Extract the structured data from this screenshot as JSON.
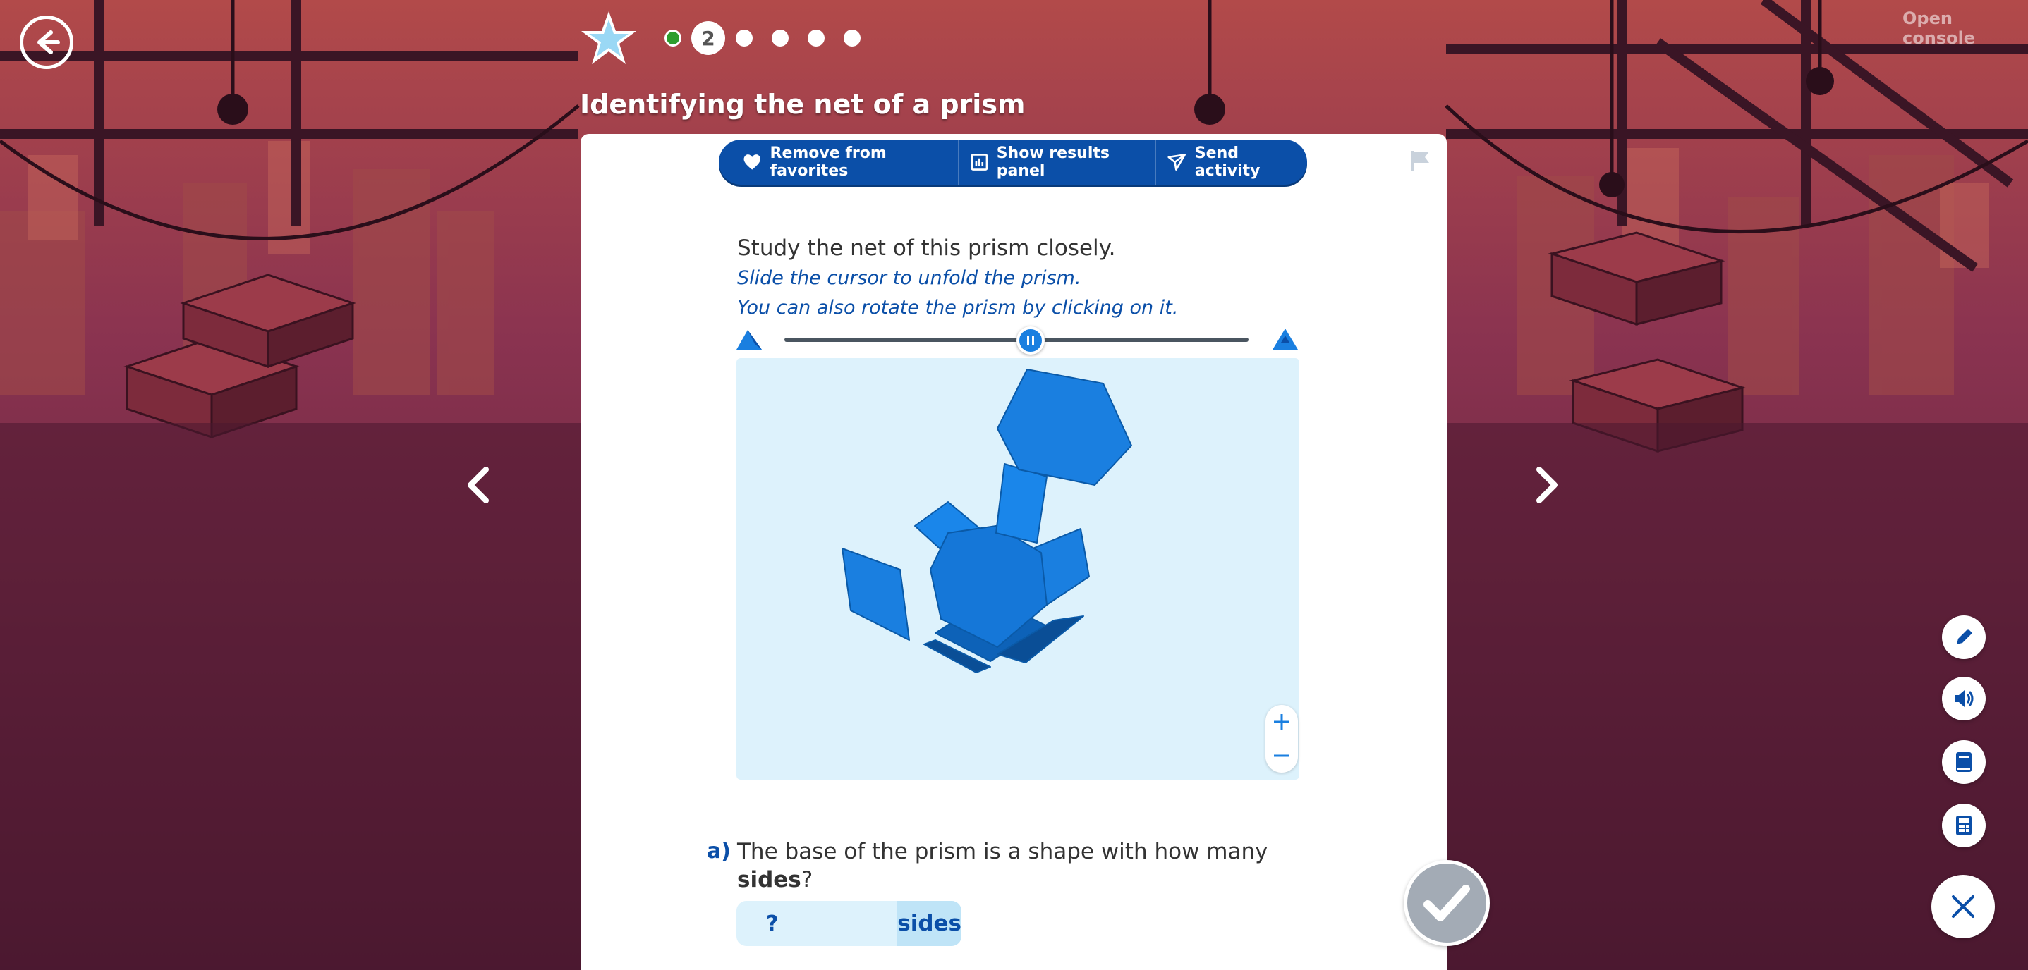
{
  "header": {
    "open_console": "Open console",
    "title": "Identifying the net of a prism",
    "progress": {
      "current_step": "2",
      "total_steps": 6,
      "completed_step_color": "#2e9e2e"
    }
  },
  "toolbar": {
    "favorites_label": "Remove from favorites",
    "results_label": "Show results panel",
    "send_label": "Send activity"
  },
  "instructions": {
    "line1": "Study the net of this prism closely.",
    "line2": "Slide the cursor to unfold the prism.",
    "line3": "You can also rotate the prism by clicking on it."
  },
  "slider": {
    "value_fraction": 0.53
  },
  "question": {
    "marker": "a)",
    "text_before": "The base of the prism is a shape with how many ",
    "text_bold": "sides",
    "text_after": "?",
    "answer_placeholder": "?",
    "answer_unit": "sides"
  },
  "colors": {
    "accent": "#0b4fa8",
    "viewer_bg": "#ddf2fc",
    "prism_face": "#1a7fe0"
  }
}
